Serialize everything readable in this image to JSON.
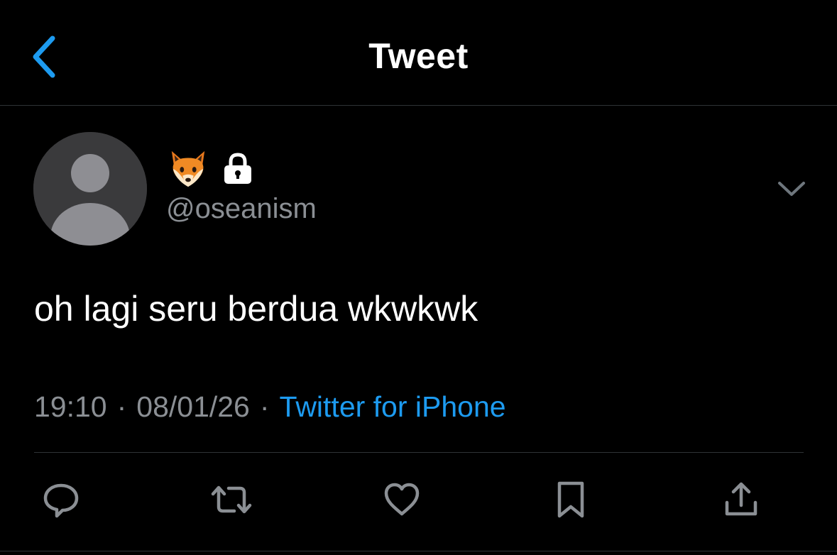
{
  "header": {
    "title": "Tweet",
    "back_icon": "chevron-left-icon"
  },
  "author": {
    "handle": "@oseanism",
    "name_emoji": "🦊",
    "protected_icon": "lock-icon",
    "avatar_icon": "default-avatar-icon"
  },
  "tweet": {
    "text": "oh lagi seru berdua wkwkwk",
    "time": "19:10",
    "date": "08/01/26",
    "separator": "·",
    "source": "Twitter for iPhone"
  },
  "actions": [
    "reply-icon",
    "retweet-icon",
    "like-icon",
    "bookmark-icon",
    "share-icon"
  ],
  "colors": {
    "background": "#000000",
    "accent": "#1d9bf0",
    "secondary_text": "#8b8f94",
    "divider": "#2f3336"
  }
}
